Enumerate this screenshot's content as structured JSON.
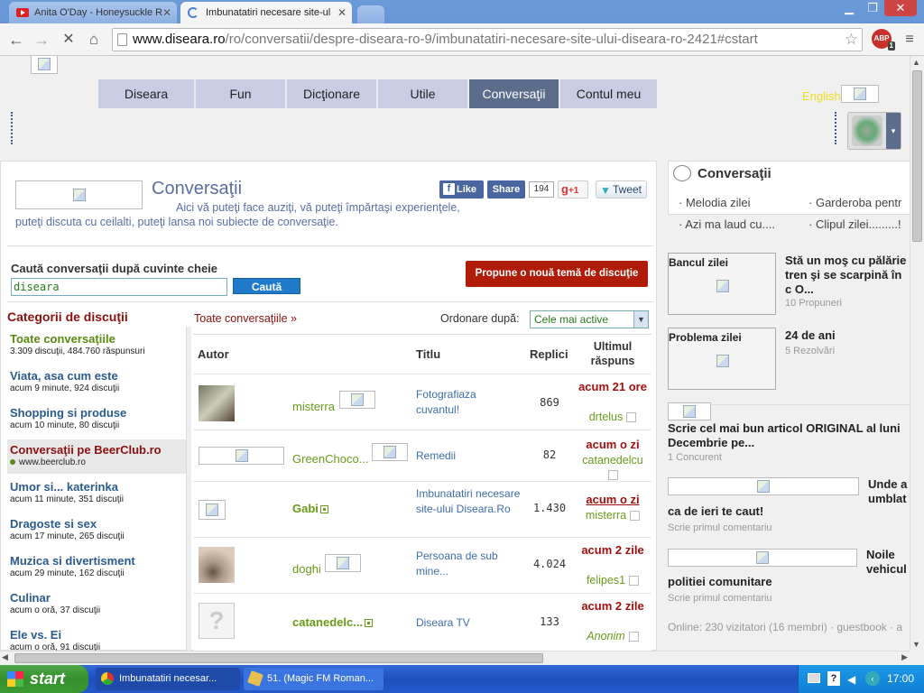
{
  "browser": {
    "tabs": [
      {
        "label": "Anita O'Day - Honeysuckle R",
        "active": false
      },
      {
        "label": "Imbunatatiri necesare site-ul",
        "active": true
      }
    ],
    "url_host": "www.diseara.ro",
    "url_path": "/ro/conversatii/despre-diseara-ro-9/imbunatatiri-necesare-site-ului-diseara-ro-2421#cstart",
    "abp_label": "ABP",
    "abp_count": "1"
  },
  "nav": {
    "items": [
      "Diseara",
      "Fun",
      "Dicţionare",
      "Utile",
      "Conversaţii",
      "Contul meu"
    ],
    "selected": 4,
    "language_link": "English"
  },
  "header": {
    "title": "Conversaţii",
    "description": "Aici vă puteţi face auziţi, vă puteţi împărtaşi experienţele, puteţi discuta cu ceilalti, puteţi lansa noi subiecte de conversaţie.",
    "like_label": "Like",
    "share_label": "Share",
    "share_count": "194",
    "plusone_label": "+1",
    "tweet_label": "Tweet"
  },
  "search": {
    "label": "Caută conversaţii după cuvinte cheie",
    "value": "diseara",
    "button": "Caută",
    "propose_button": "Propune o nouă temă de discuţie"
  },
  "categories": {
    "title": "Categorii de discuţii",
    "items": [
      {
        "name": "Toate conversaţiile",
        "meta": "3.309 discuţii,  484.760 răspunsuri"
      },
      {
        "name": "Viata, asa cum este",
        "meta": "acum 9 minute,  924 discuţii"
      },
      {
        "name": "Shopping si produse",
        "meta": "acum 10 minute,  80 discuţii"
      },
      {
        "name": "Conversaţii pe BeerClub.ro",
        "meta": "www.beerclub.ro"
      },
      {
        "name": "Umor si... katerinka",
        "meta": "acum 11 minute,  351 discuţii"
      },
      {
        "name": "Dragoste si sex",
        "meta": "acum 17 minute,  265 discuţii"
      },
      {
        "name": "Muzica si divertisment",
        "meta": "acum 29 minute,  162 discuţii"
      },
      {
        "name": "Culinar",
        "meta": "acum o oră,  37 discuţii"
      },
      {
        "name": "Ele vs. Ei",
        "meta": "acum o oră,  91 discuţii"
      }
    ]
  },
  "list": {
    "breadcrumb": "Toate conversaţiile »",
    "sort_label": "Ordonare după:",
    "sort_value": "Cele mai active",
    "columns": [
      "Autor",
      "Titlu",
      "Replici",
      "Ultimul răspuns"
    ],
    "rows": [
      {
        "author": "misterra",
        "title": "Fotografiaza cuvantul!",
        "replies": "869",
        "last": "acum 21 ore",
        "last_user": "drtelus"
      },
      {
        "author": "GreenChoco...",
        "title": "Remedii",
        "replies": "82",
        "last": "acum o zi",
        "last_user": "catanedelcu"
      },
      {
        "author": "Gabi",
        "title": "Imbunatatiri necesare site-ului Diseara.Ro",
        "replies": "1.430",
        "last": "acum o zi",
        "last_user": "misterra"
      },
      {
        "author": "doghi",
        "title": "Persoana de sub mine...",
        "replies": "4.024",
        "last": "acum 2 zile",
        "last_user": "felipes1"
      },
      {
        "author": "catanedelc...",
        "title": "Diseara TV",
        "replies": "133",
        "last": "acum 2 zile",
        "last_user": "Anonim"
      }
    ]
  },
  "sidebar": {
    "title": "Conversaţii",
    "links": [
      "Melodia zilei",
      "Garderoba pentr",
      "Azi ma laud cu....",
      "Clipul zilei.........!"
    ],
    "bancul": {
      "label": "Bancul zilei",
      "text": "Stă un moş cu pălărie tren şi se scarpină în c O...",
      "meta": "10 Propuneri"
    },
    "problema": {
      "label": "Problema zilei",
      "text": "24 de ani",
      "meta": "5 Rezolvări"
    },
    "article": {
      "text": "Scrie cel mai bun articol ORIGINAL al luni Decembrie pe...",
      "meta": "1 Concurent"
    },
    "news1": {
      "title_right": "Unde a umblat",
      "title_full": "ca de ieri te caut!",
      "meta": "Scrie primul comentariu"
    },
    "news2": {
      "title_right": "Noile vehicul",
      "title_full": "politiei comunitare",
      "meta": "Scrie primul comentariu"
    },
    "online": "Online: 230 vizitatori (16 membri) · guestbook · a"
  },
  "taskbar": {
    "start": "start",
    "items": [
      "Imbunatatiri necesar...",
      "51. (Magic FM Roman..."
    ],
    "clock": "17:00"
  }
}
